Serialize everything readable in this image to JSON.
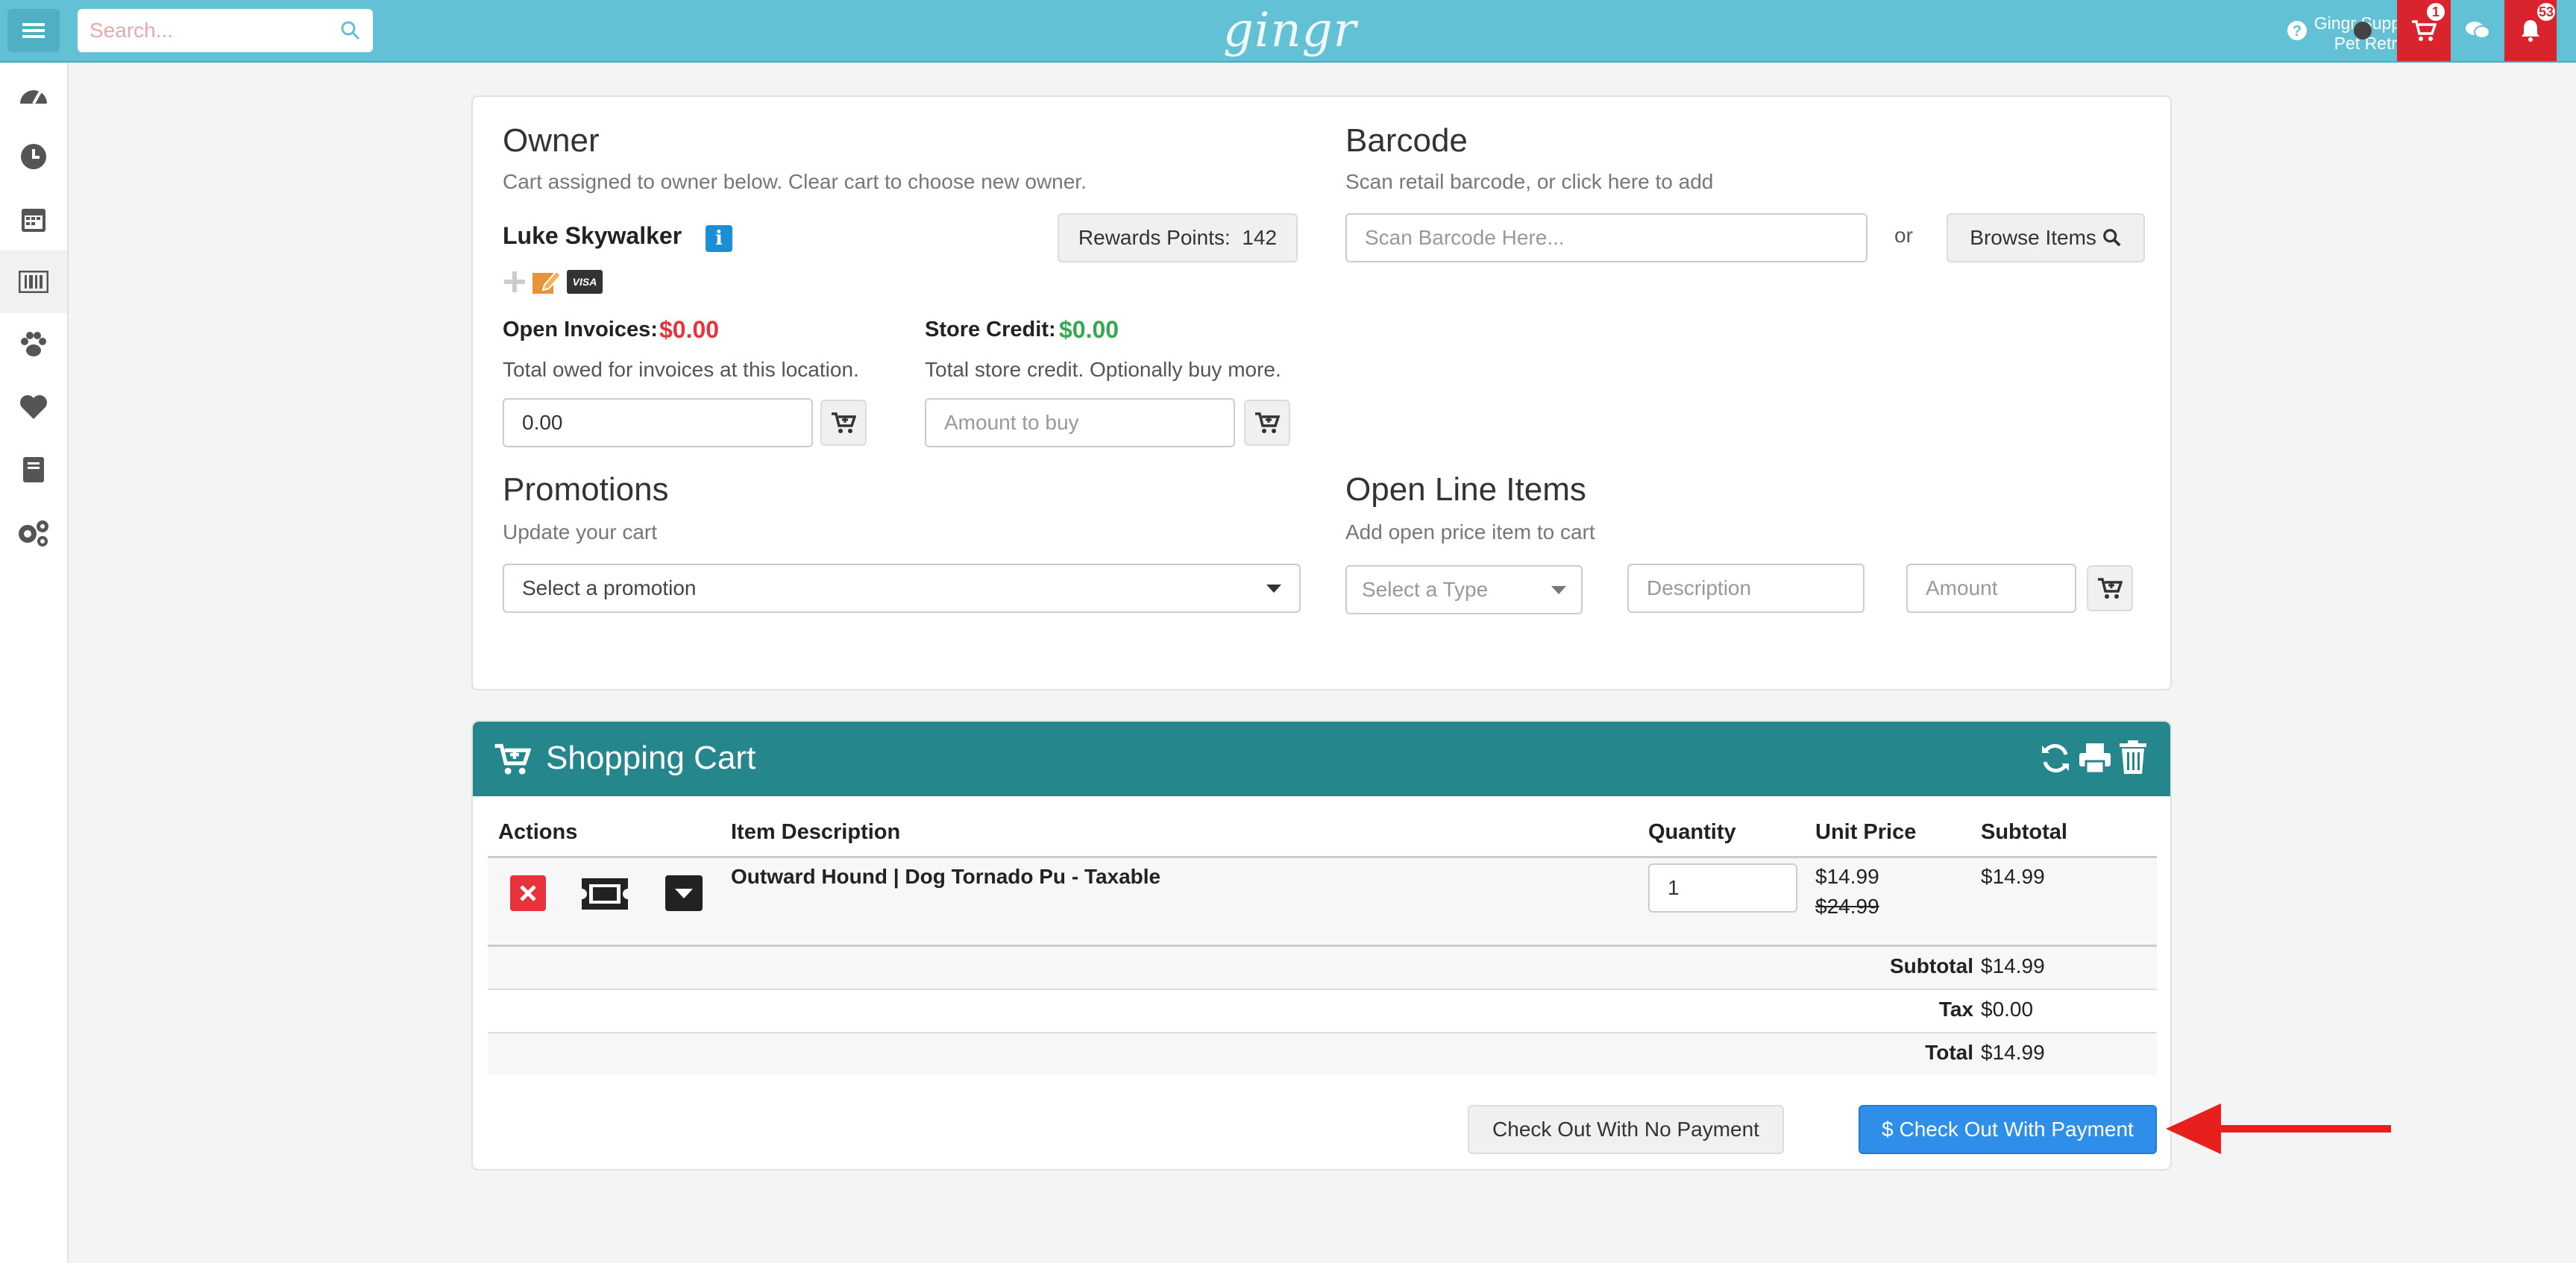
{
  "topbar": {
    "search_placeholder": "Search...",
    "logo": "gingr",
    "user_name": "Gingr Support",
    "user_location": "Pet Retreat",
    "cart_badge": "1",
    "notif_badge": "53"
  },
  "owner": {
    "heading": "Owner",
    "subtitle": "Cart assigned to owner below. Clear cart to choose new owner.",
    "name": "Luke Skywalker",
    "rewards_label": "Rewards Points:",
    "rewards_value": "142",
    "open_invoices_label": "Open Invoices:",
    "open_invoices_value": "$0.00",
    "open_invoices_desc": "Total owed for invoices at this location.",
    "invoice_amount": "0.00",
    "store_credit_label": "Store Credit:",
    "store_credit_value": "$0.00",
    "store_credit_desc": "Total store credit. Optionally buy more.",
    "amount_placeholder": "Amount to buy",
    "visa_label": "VISA"
  },
  "barcode": {
    "heading": "Barcode",
    "subtitle": "Scan retail barcode, or click here to add",
    "placeholder": "Scan Barcode Here...",
    "or": "or",
    "browse_label": "Browse Items"
  },
  "promotions": {
    "heading": "Promotions",
    "subtitle": "Update your cart",
    "select_value": "Select a promotion"
  },
  "open_line_items": {
    "heading": "Open Line Items",
    "subtitle": "Add open price item to cart",
    "type_value": "Select a Type",
    "description_placeholder": "Description",
    "amount_placeholder": "Amount"
  },
  "cart": {
    "title": "Shopping Cart",
    "headers": {
      "actions": "Actions",
      "item": "Item Description",
      "quantity": "Quantity",
      "unit_price": "Unit Price",
      "subtotal": "Subtotal"
    },
    "item": {
      "description": "Outward Hound | Dog Tornado Pu - Taxable",
      "quantity": "1",
      "unit_price": "$14.99",
      "original_price": "$24.99",
      "subtotal": "$14.99"
    },
    "totals": {
      "subtotal_label": "Subtotal",
      "subtotal_value": "$14.99",
      "tax_label": "Tax",
      "tax_value": "$0.00",
      "total_label": "Total",
      "total_value": "$14.99"
    },
    "checkout_no_payment": "Check Out With No Payment",
    "checkout_payment": "$ Check Out With Payment"
  },
  "colors": {
    "topbar": "#62c1d4",
    "cart_header": "#25878c",
    "primary_button": "#2f8ee8",
    "danger": "#e8333a",
    "success": "#35a853",
    "arrow": "#e8201d"
  }
}
